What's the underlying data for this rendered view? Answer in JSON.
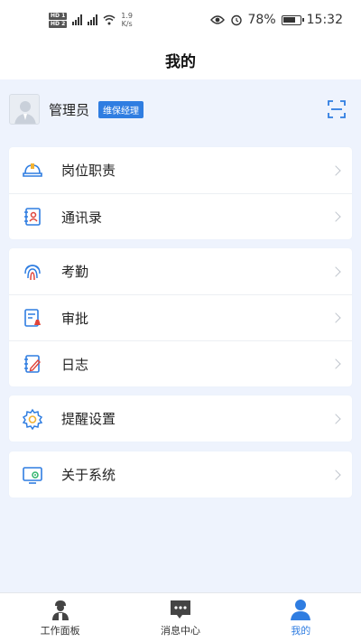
{
  "status_bar": {
    "net_speed": "1.9",
    "net_unit": "K/s",
    "battery": "78%",
    "time": "15:32"
  },
  "header": {
    "title": "我的"
  },
  "profile": {
    "name": "管理员",
    "role": "维保经理"
  },
  "menu_groups": [
    [
      {
        "label": "岗位职责",
        "icon": "helmet-icon"
      },
      {
        "label": "通讯录",
        "icon": "contacts-icon"
      }
    ],
    [
      {
        "label": "考勤",
        "icon": "fingerprint-icon"
      },
      {
        "label": "审批",
        "icon": "approval-icon"
      },
      {
        "label": "日志",
        "icon": "log-edit-icon"
      }
    ],
    [
      {
        "label": "提醒设置",
        "icon": "gear-icon"
      }
    ],
    [
      {
        "label": "关于系统",
        "icon": "system-monitor-icon"
      }
    ]
  ],
  "tabbar": [
    {
      "label": "工作面板",
      "icon": "worker-icon"
    },
    {
      "label": "消息中心",
      "icon": "message-icon"
    },
    {
      "label": "我的",
      "icon": "user-icon",
      "active": true
    }
  ],
  "colors": {
    "accent": "#2f7de1",
    "background": "#eef3fd",
    "icon_red": "#e0443a"
  }
}
